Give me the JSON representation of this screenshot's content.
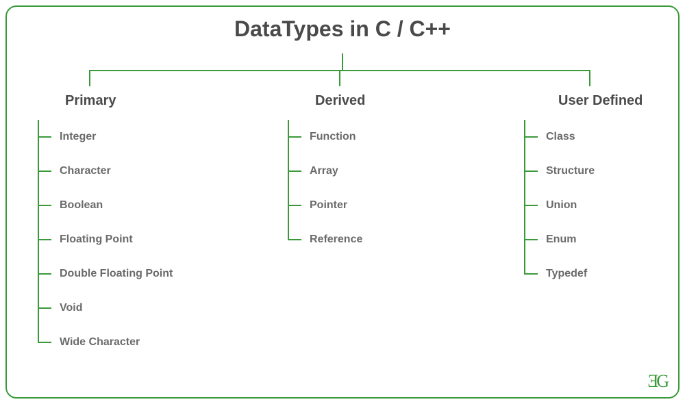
{
  "title": "DataTypes in C / C++",
  "categories": [
    {
      "label": "Primary",
      "items": [
        "Integer",
        "Character",
        "Boolean",
        "Floating Point",
        "Double Floating Point",
        "Void",
        "Wide Character"
      ]
    },
    {
      "label": "Derived",
      "items": [
        "Function",
        "Array",
        "Pointer",
        "Reference"
      ]
    },
    {
      "label": "User Defined",
      "items": [
        "Class",
        "Structure",
        "Union",
        "Enum",
        "Typedef"
      ]
    }
  ],
  "logo": "ƎG",
  "layout": {
    "col_x": [
      130,
      495,
      860
    ],
    "label_x": [
      95,
      460,
      815
    ],
    "items_x": [
      55,
      420,
      765
    ]
  }
}
